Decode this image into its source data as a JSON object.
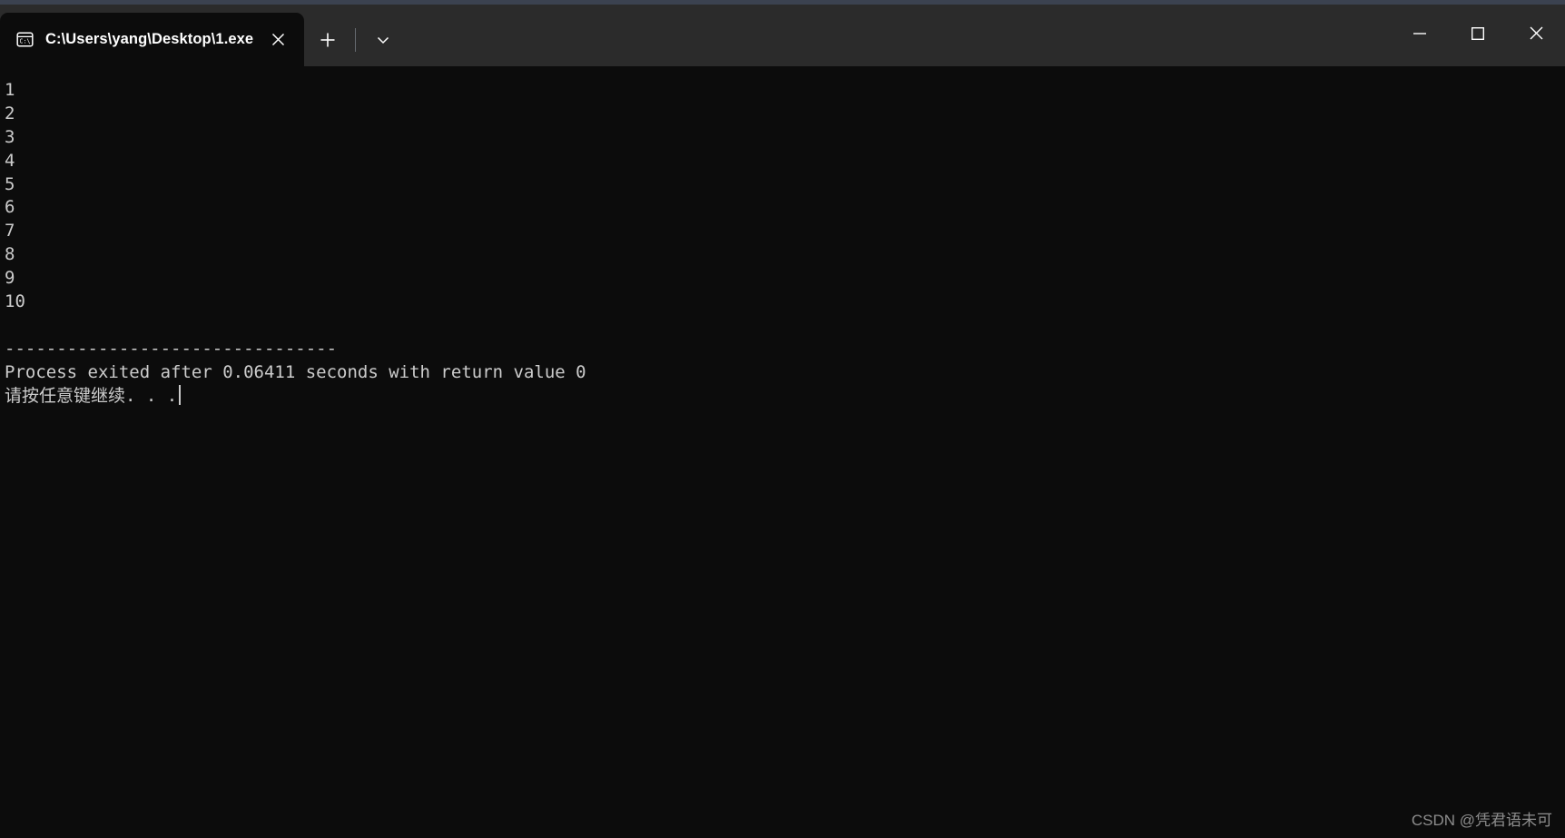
{
  "window": {
    "title": "C:\\Users\\yang\\Desktop\\1.exe",
    "tab_icon": "console-cmd-icon",
    "close_tab_icon": "close-icon",
    "new_tab_icon": "plus-icon",
    "dropdown_icon": "chevron-down-icon",
    "minimize_icon": "minimize-icon",
    "maximize_icon": "maximize-icon",
    "close_icon": "close-icon",
    "colors": {
      "titlebar_bg": "#2b2b2b",
      "terminal_bg": "#0c0c0c",
      "terminal_fg": "#cccccc",
      "edge_strip": "#3b4250",
      "tab_active_bg": "#0c0c0c"
    }
  },
  "terminal": {
    "lines": [
      "1",
      "2",
      "3",
      "4",
      "5",
      "6",
      "7",
      "8",
      "9",
      "10",
      "",
      "--------------------------------",
      "Process exited after 0.06411 seconds with return value 0",
      "请按任意键继续. . ."
    ]
  },
  "watermark": {
    "text": "CSDN @凭君语未可"
  }
}
